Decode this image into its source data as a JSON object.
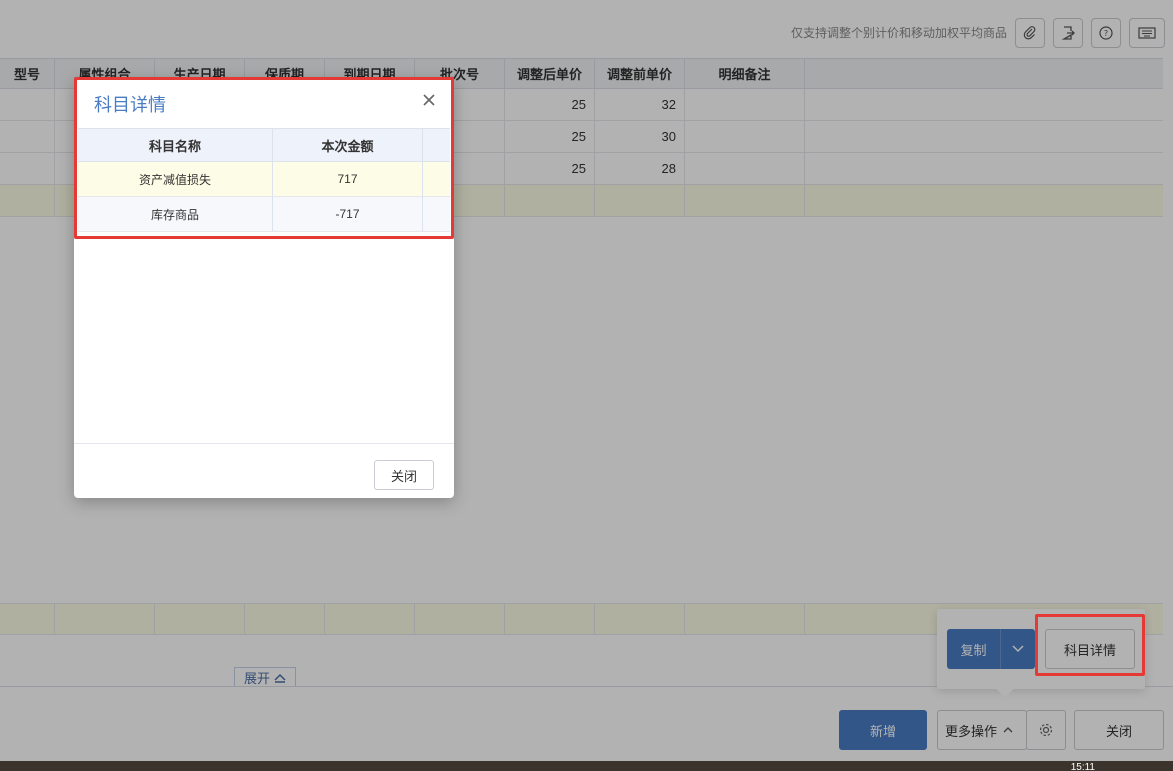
{
  "toolbar": {
    "hint": "仅支持调整个别计价和移动加权平均商品",
    "icons": [
      "paperclip-icon",
      "export-icon",
      "help-icon",
      "keyboard-icon"
    ]
  },
  "grid": {
    "columns": [
      "型号",
      "属性组合",
      "生产日期",
      "保质期",
      "到期日期",
      "批次号",
      "调整后单价",
      "调整前单价",
      "明细备注"
    ],
    "rows": [
      {
        "after": "25",
        "before": "32"
      },
      {
        "after": "25",
        "before": "30"
      },
      {
        "after": "25",
        "before": "28"
      }
    ],
    "expand_label": "展开"
  },
  "modal": {
    "title": "科目详情",
    "columns": [
      "科目名称",
      "本次金额"
    ],
    "rows": [
      {
        "name": "资产减值损失",
        "amount": "717"
      },
      {
        "name": "库存商品",
        "amount": "-717"
      }
    ],
    "close_label": "关闭"
  },
  "popover": {
    "copy_label": "复制",
    "detail_label": "科目详情"
  },
  "footer": {
    "new_label": "新增",
    "more_label": "更多操作",
    "close_label": "关闭"
  },
  "system": {
    "clock": "15:11"
  },
  "colors": {
    "primary": "#4a7cc4",
    "highlight": "#e53935",
    "summary_row": "#fdfce6"
  }
}
